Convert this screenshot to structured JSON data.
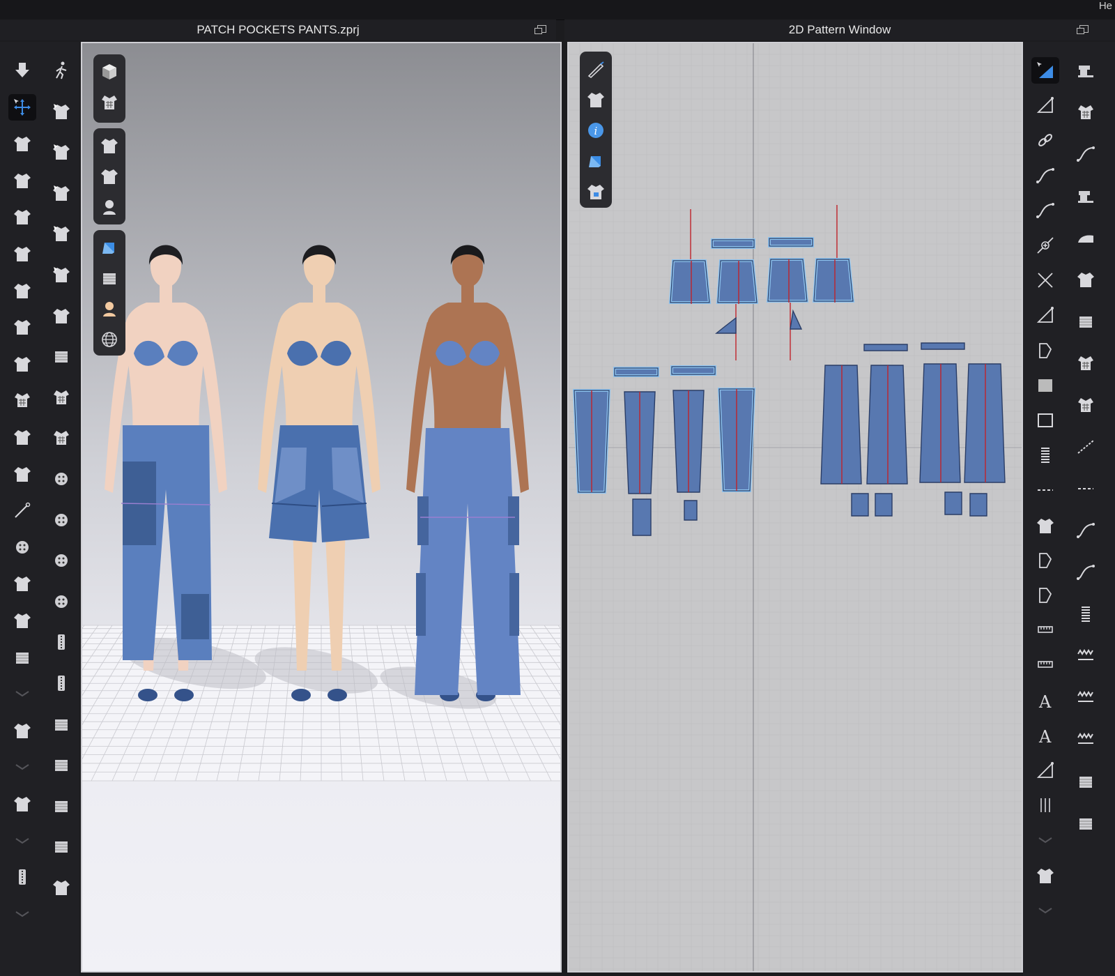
{
  "window": {
    "corner_text": "He"
  },
  "viewport3d": {
    "title": "PATCH POCKETS PANTS.zprj",
    "bg_top": "#8e8f94",
    "bg_bottom": "#f0f0f5",
    "avatars": [
      {
        "skin": "#f1d2c1",
        "hair": "#1f1f22",
        "garment": "#5a7fbe",
        "patch": "#3e5f95",
        "style": "long-pants-knee-patch"
      },
      {
        "skin": "#efcfb2",
        "hair": "#1c1c1f",
        "garment": "#4a70ae",
        "patch": "#3a5d97",
        "style": "shorts"
      },
      {
        "skin": "#ad7453",
        "hair": "#1a1a1c",
        "garment": "#6384c4",
        "patch": "#45659e",
        "style": "wide-pants-side-pocket"
      }
    ]
  },
  "pattern2d": {
    "title": "2D Pattern Window",
    "bg": "#c7c7c9",
    "piece_fill": "#5878b0",
    "piece_outline": "#8ec4f0",
    "seam_color": "#c0232b"
  },
  "toolbars": {
    "left_col1": [
      "arrow-down-icon",
      "select-move-icon",
      "lasso-select-icon",
      "marquee-select-icon",
      "garment-fit-icon",
      "garment-shrink-icon",
      "garment-expand-icon",
      "garment-drape-icon",
      "pin-garment-icon",
      "grid-pin-icon",
      "garment-flip-icon",
      "avatar-garment-icon",
      "needle-icon",
      "button-tool-icon",
      "topstitch-icon",
      "fold-icon",
      "layer-icon",
      "collapse-chevron-icon",
      "measure-up-icon",
      "collapse-chevron-icon",
      "seam-arc-icon",
      "collapse-chevron-icon",
      "zipper-tag-icon",
      "collapse-chevron-icon"
    ],
    "left_col2": [
      "avatar-walk-icon",
      "tack-icon",
      "tack-edit-icon",
      "tack-arrow-icon",
      "hanger-icon",
      "hanger-cross-icon",
      "fold-arrange-icon",
      "fabric-fold-icon",
      "garment-checker-icon",
      "garment-checker2-icon",
      "button-add-icon",
      "button-icon",
      "buttonhole-icon",
      "lock-button-icon",
      "zipper-icon",
      "zipper-slider-icon",
      "fabric-roll-icon",
      "fabric-square-icon",
      "fabric-roll2-icon",
      "fabric-square2-icon",
      "tape-join-icon"
    ],
    "vpanel_left": [
      "box-view-icon",
      "shirt-grid-icon",
      "tshirt-icon",
      "avatar-tool-icon",
      "avatar-head-icon",
      "fabric-blue-icon",
      "fabric-shade-icon",
      "skin-icon",
      "globe-icon"
    ],
    "vpanel_right": [
      "pen-tool-icon",
      "tshirt-icon",
      "info-icon",
      "fabric-blue-icon",
      "shirt-lock-icon"
    ],
    "right_col1": [
      "select-triangle-icon",
      "edit-triangle-icon",
      "link-icon",
      "curve-icon",
      "curve-point-icon",
      "add-point-icon",
      "cut-icon",
      "angle-icon",
      "pentagon-icon",
      "rectangle-fill-icon",
      "rectangle-icon",
      "spring-icon",
      "dashed-rect-icon",
      "pattern-copy-icon",
      "notch-icon",
      "fold-piece-icon",
      "ruler-icon",
      "ruler-horizontal-icon",
      "text-A-icon",
      "text-A-plain-icon",
      "angle-measure-icon",
      "vertical-lines-icon",
      "collapse-chevron-icon",
      "flip-icon",
      "collapse-chevron-icon"
    ],
    "right_col2": [
      "sewing-machine-icon",
      "grid-points-icon",
      "machine-curve-icon",
      "machine-search-icon",
      "iron-icon",
      "tshirt-icon",
      "fabric-press-icon",
      "checker-shirt-icon",
      "checker-shirt2-icon",
      "line-segment-icon",
      "dashed-line-icon",
      "wave-line-icon",
      "machine-wave-icon",
      "spring-vertical-icon",
      "zigzag-icon",
      "zigzag-double-icon",
      "zigzag-machine-icon",
      "plus-fabric-icon",
      "stack-icon"
    ]
  }
}
